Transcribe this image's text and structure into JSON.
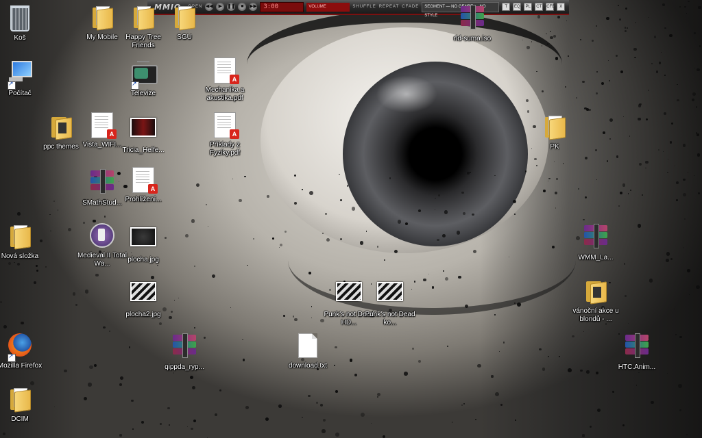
{
  "desktop": {
    "icons": {
      "kos": "Koš",
      "my_mobile": "My Mobile",
      "happy_tree": "Happy Tree Friends",
      "sgu": "SGU",
      "rld": "rld-suma.iso",
      "pocitac": "Počítač",
      "televize": "Televize",
      "mechanika": "Mechanika a akustika.pdf",
      "ppc_themes": "ppc themes",
      "vista": "Vista_WIFI...",
      "tricia": "Tricia_Helfe...",
      "priklady": "Příklady z Fyziky.pdf",
      "pk": "PK",
      "smath": "SMathStud...",
      "prohlizeni": "Prohlížení...",
      "nova_slozka": "Nová složka",
      "medieval": "Medieval II Total Wa...",
      "plocha": "plocha.jpg",
      "wmm": "WMM_La...",
      "plocha2": "plocha2.jpg",
      "punk_hd": "Punk's not Dead HD...",
      "punk_ko": "Punk's not Dead ko...",
      "vanocni": "vánoční akce u blondů - ...",
      "firefox": "Mozilla Firefox",
      "qippda": "qippda_ryp...",
      "download": "download.txt",
      "htc": "HTC.Anim...",
      "dcim": "DCIM"
    },
    "icon_kinds": {
      "folder": "folder-icon",
      "pdf": "pdf-document-icon",
      "rar": "winrar-archive-icon",
      "image": "image-file-icon",
      "text": "text-file-icon",
      "recycle": "recycle-bin-icon",
      "computer": "computer-icon",
      "tv": "television-icon",
      "game": "medieval-game-icon",
      "browser": "firefox-icon"
    }
  },
  "player": {
    "logo": "MMIO",
    "tiny_label_1": "OPEN",
    "play_glyph": "▶",
    "pause_glyph": "❚❚",
    "stop_glyph": "■",
    "prev_glyph": "◀◀",
    "next_glyph": "▶▶",
    "time": "3:00",
    "volume_label": "VOLUME",
    "shuffle": "SHUFFLE",
    "repeat": "REPEAT",
    "crossfade": "CFADE",
    "genre_group": "SEGMENT — NO GENRE — NO STYLE",
    "btn_t": "T",
    "btn_eq": "EQ",
    "btn_pl": "PL",
    "btn_ct": "CT",
    "btn_cfe": "CFE",
    "close": "X",
    "accent": "#7a0c0c"
  }
}
